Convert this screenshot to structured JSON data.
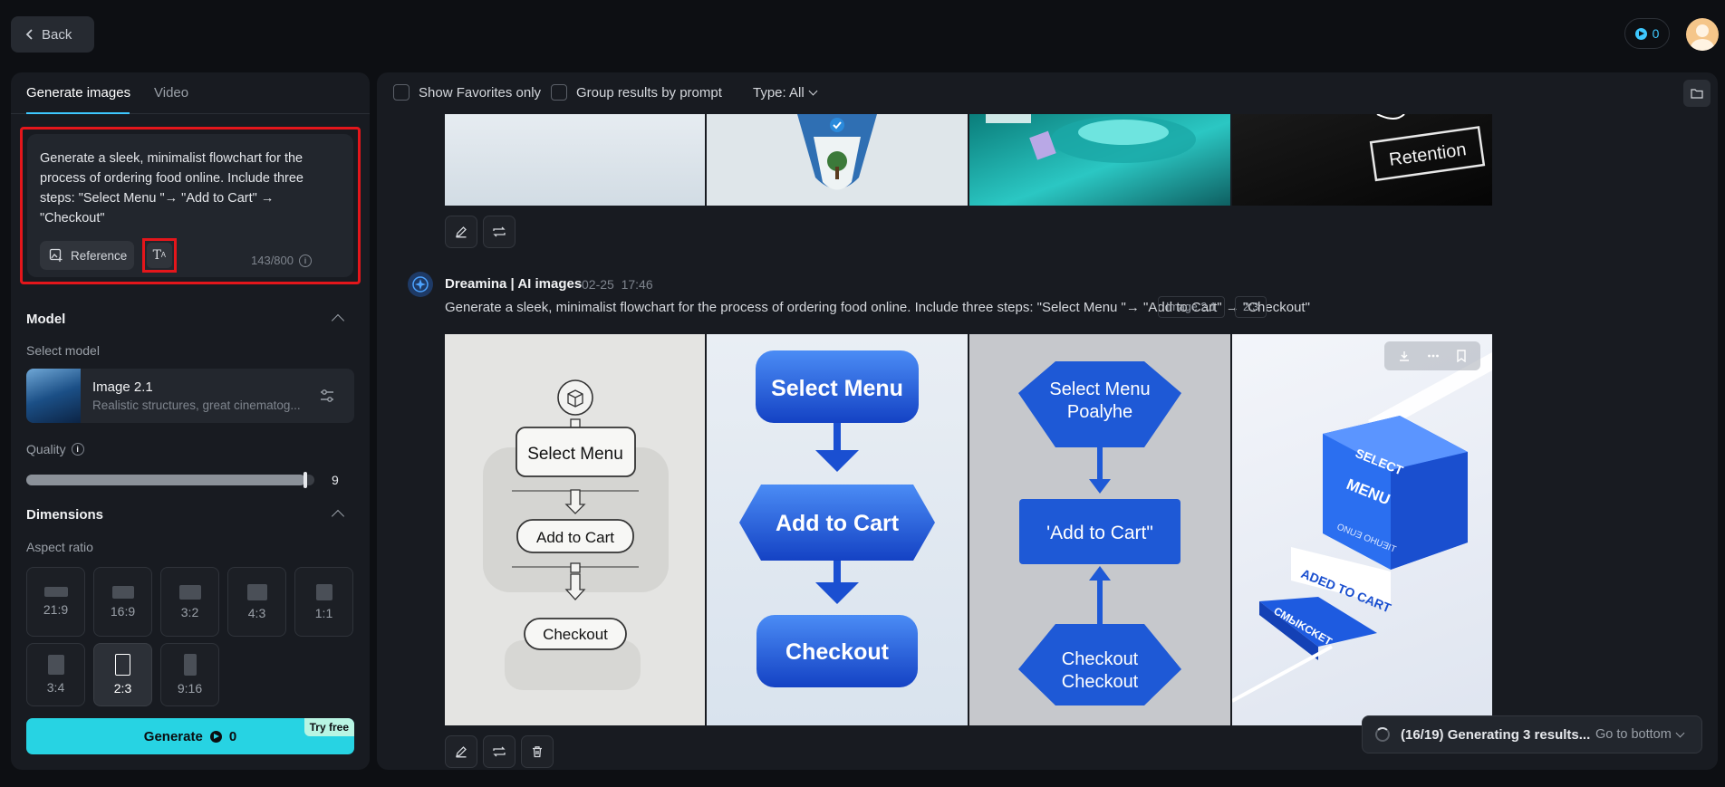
{
  "topbar": {
    "back_label": "Back",
    "credits": "0"
  },
  "left": {
    "tabs": [
      "Generate images",
      "Video"
    ],
    "prompt": "Generate a sleek, minimalist flowchart for the process of ordering food online. Include three steps: \"Select Menu \"→ \"Add to Cart\" → \"Checkout\"",
    "reference_label": "Reference",
    "counter": "143/800",
    "model_section": "Model",
    "select_model_label": "Select model",
    "model_name": "Image 2.1",
    "model_desc": "Realistic structures, great cinematog...",
    "quality_label": "Quality",
    "quality_value": "9",
    "quality_fraction": 0.97,
    "dimensions_section": "Dimensions",
    "aspect_label": "Aspect ratio",
    "ratios": [
      "21:9",
      "16:9",
      "3:2",
      "4:3",
      "1:1",
      "3:4",
      "2:3",
      "9:16"
    ],
    "selected_ratio": "2:3",
    "generate_label": "Generate",
    "generate_cost": "0",
    "try_free": "Try free"
  },
  "right": {
    "show_favorites": "Show Favorites only",
    "group_results": "Group results by prompt",
    "type_filter": "Type: All",
    "prev_row_text": "Retention",
    "message": {
      "author": "Dreamina | AI images",
      "date": "02-25",
      "time": "17:46",
      "prompt": "Generate a sleek, minimalist flowchart for the process of ordering food online. Include three steps: \"Select Menu \"→ \"Add to Cart\" → \"Checkout\"",
      "model_tag": "Image 2.1",
      "ratio_tag": "2:3"
    },
    "images": {
      "img1": [
        "Select Menu",
        "Add to Cart",
        "Checkout"
      ],
      "img2": [
        "Select Menu",
        "Add to Cart",
        "Checkout"
      ],
      "img3": [
        "Select Menu",
        "Poalyhe",
        "'Add to Cart\"",
        "Checkout",
        "Checkout"
      ],
      "img4": [
        "SELECT",
        "MENU",
        "ONUƎ OHUƎIT",
        "ADED TO CART",
        "CMЫKCKET"
      ]
    },
    "progress": "(16/19) Generating 3 results...",
    "go_to_bottom": "Go to bottom"
  },
  "colors": {
    "accent": "#27d3e3",
    "highlight": "#e4161b",
    "credit": "#3ec8ff"
  }
}
